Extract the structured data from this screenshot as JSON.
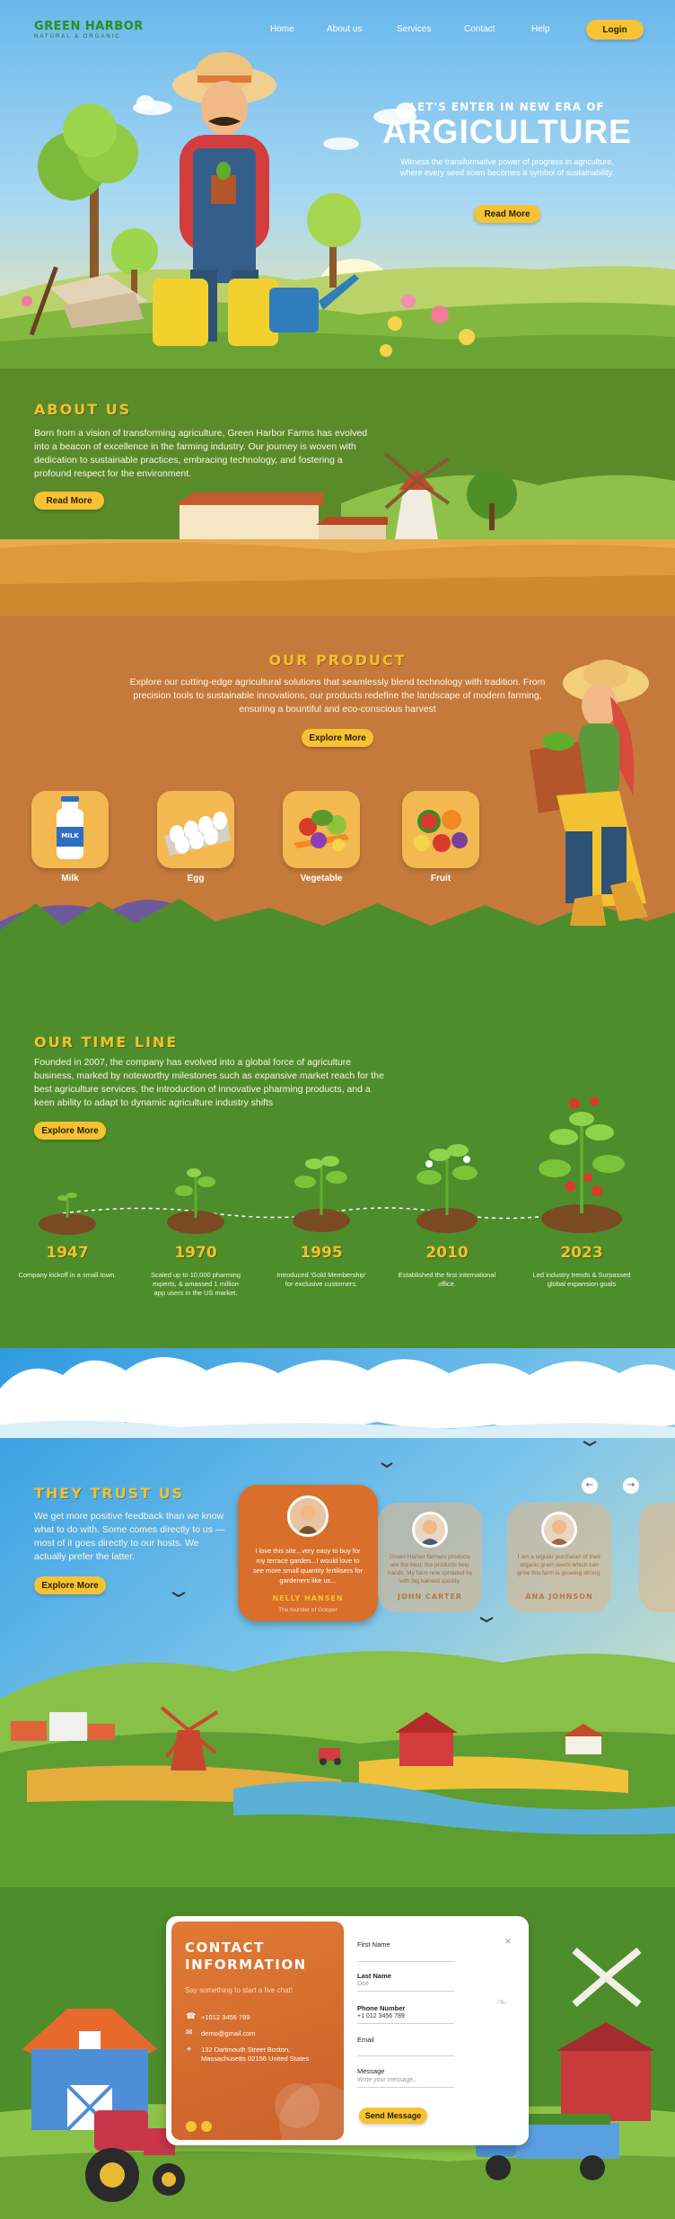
{
  "brand": {
    "name": "GREEN HARBOR",
    "tagline": "NATURAL & ORGANIC"
  },
  "nav": {
    "items": [
      "Home",
      "About us",
      "Services",
      "Contact",
      "Help"
    ],
    "login": "Login"
  },
  "hero": {
    "kicker": "LET'S ENTER IN NEW ERA OF",
    "title": "ARGICULTURE",
    "subtitle": "Witness the transformative power of progress in agriculture, where every seed sown becomes a symbol of sustainability.",
    "cta": "Read More"
  },
  "about": {
    "title": "ABOUT  US",
    "text": "Born from a vision of transforming agriculture, Green Harbor Farms has evolved into a beacon of excellence in the farming industry. Our journey is woven with dedication to sustainable practices, embracing technology, and fostering a profound respect for the environment.",
    "cta": "Read More"
  },
  "product": {
    "title": "OUR PRODUCT",
    "text": "Explore our cutting-edge agricultural solutions that seamlessly blend technology with tradition. From precision tools to sustainable innovations, our products redefine the landscape of modern farming, ensuring a bountiful and eco-conscious harvest",
    "cta": "Explore More",
    "items": [
      {
        "label": "Milk",
        "badge": "MILK"
      },
      {
        "label": "Egg"
      },
      {
        "label": "Vegetable"
      },
      {
        "label": "Fruit"
      }
    ]
  },
  "timeline": {
    "title": "OUR TIME LINE",
    "text": "Founded in 2007, the company has evolved into a global force of agriculture business, marked by noteworthy milestones such as expansive market reach for the best agriculture services, the introduction of innovative pharming products, and a keen ability to adapt to dynamic agriculture industry shifts",
    "cta": "Explore More",
    "events": [
      {
        "year": "1947",
        "desc": "Company kickoff in a small town."
      },
      {
        "year": "1970",
        "desc": "Scaled up to 10,000 pharming experts, & amassed 1 million app users in the US market."
      },
      {
        "year": "1995",
        "desc": "Introduced 'Gold Membership' for exclusive customers."
      },
      {
        "year": "2010",
        "desc": "Established the first international office."
      },
      {
        "year": "2023",
        "desc": "Led industry trends & Surpassed global expansion goals"
      }
    ]
  },
  "trust": {
    "title": "THEY TRUST US",
    "text": "We get more positive feedback than we know what to do with. Some comes directly to us — most of it goes directly to our hosts. We actually prefer the latter.",
    "cta": "Explore More",
    "prev": "←",
    "next": "→",
    "testimonials": [
      {
        "quote": "I love this site...very easy to buy for my terrace garden...I would love to see more small quantity fertilisers for gardeners like us...",
        "name": "NELLY HANSEN",
        "role": "The founder of Gooper"
      },
      {
        "quote": "Green Harbor farmers products are the best. the products help hands. My farm now sprouted by with big harvest quickly.",
        "name": "JOHN CARTER"
      },
      {
        "quote": "I am a regular purchaser of their organic grain seeds which can grow this farm is growing strong.",
        "name": "ANA JOHNSON"
      }
    ]
  },
  "contact": {
    "title": "CONTACT INFORMATION",
    "subtitle": "Say something to start a live chat!",
    "phone": "+1012 3456 789",
    "email": "demo@gmail.com",
    "address": "132 Dartmouth Street Boston, Massachusetts 02156 United States",
    "fields": {
      "first_name_label": "First Name",
      "first_name_ph": "",
      "last_name_label": "Last Name",
      "last_name_ph": "Doe",
      "phone_label": "Phone Number",
      "phone_ph": "+1 012 3456 789",
      "email_label": "Email",
      "email_ph": "",
      "message_label": "Message",
      "message_ph": "Write your message.."
    },
    "send": "Send Message"
  },
  "colors": {
    "accent": "#f7c233",
    "green": "#4e8d2c",
    "orange": "#c9773a"
  }
}
